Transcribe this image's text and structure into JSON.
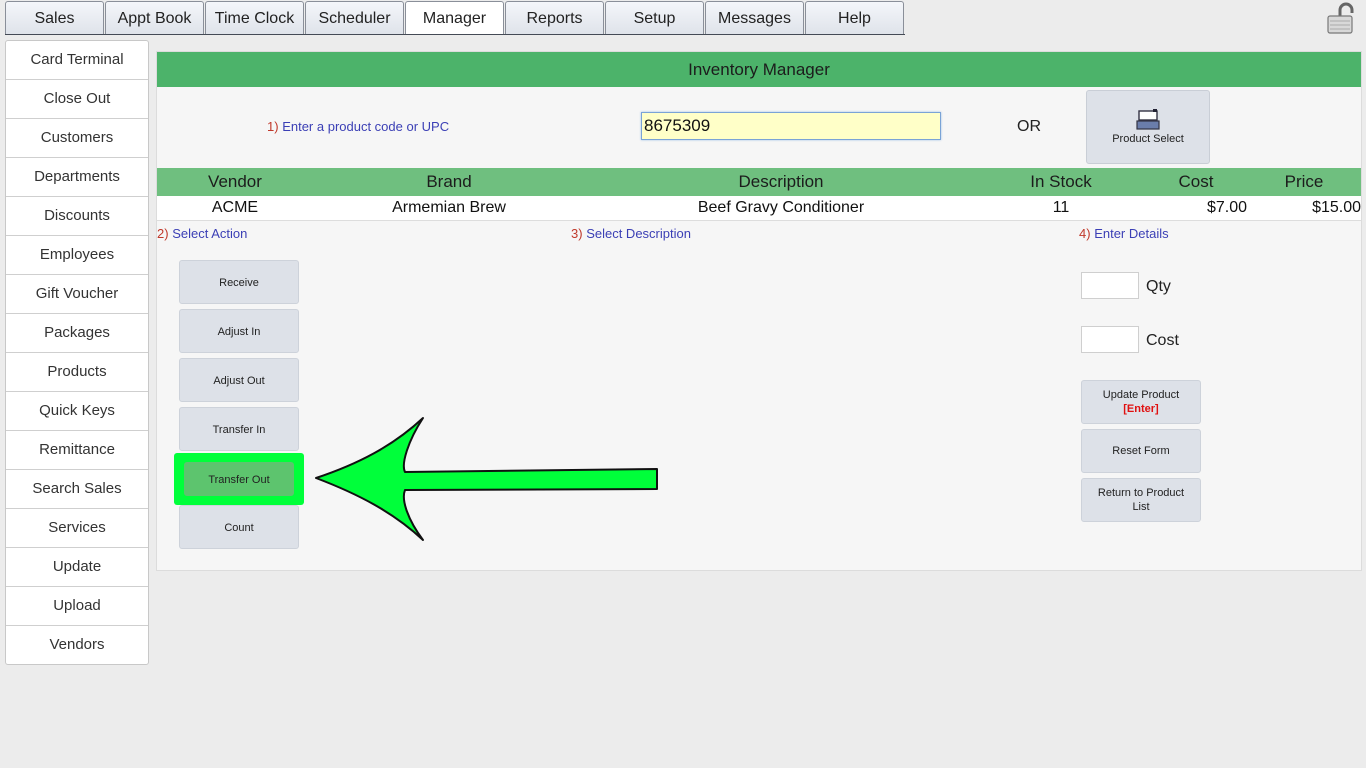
{
  "tabs": [
    "Sales",
    "Appt Book",
    "Time Clock",
    "Scheduler",
    "Manager",
    "Reports",
    "Setup",
    "Messages",
    "Help"
  ],
  "active_tab": "Manager",
  "sidebar": {
    "items": [
      "Card Terminal",
      "Close Out",
      "Customers",
      "Departments",
      "Discounts",
      "Employees",
      "Gift Voucher",
      "Packages",
      "Products",
      "Quick Keys",
      "Remittance",
      "Search Sales",
      "Services",
      "Update",
      "Upload",
      "Vendors"
    ]
  },
  "main": {
    "title": "Inventory Manager",
    "step1": {
      "num": "1)",
      "label": "Enter a product code or UPC"
    },
    "product_code_value": "8675309",
    "or_label": "OR",
    "product_select_label": "Product Select",
    "table": {
      "headers": {
        "vendor": "Vendor",
        "brand": "Brand",
        "description": "Description",
        "in_stock": "In Stock",
        "cost": "Cost",
        "price": "Price"
      },
      "row": {
        "vendor": "ACME",
        "brand": "Armemian Brew",
        "description": "Beef Gravy Conditioner",
        "in_stock": "11",
        "cost": "$7.00",
        "price": "$15.00"
      }
    },
    "step2": {
      "num": "2)",
      "label": "Select Action"
    },
    "step3": {
      "num": "3)",
      "label": "Select Description"
    },
    "step4": {
      "num": "4)",
      "label": "Enter Details"
    },
    "actions": [
      "Receive",
      "Adjust In",
      "Adjust Out",
      "Transfer In",
      "Transfer Out",
      "Count"
    ],
    "highlighted_action": "Transfer Out",
    "details": {
      "qty_label": "Qty",
      "cost_label": "Cost",
      "update_label": "Update Product",
      "update_hint": "[Enter]",
      "reset_label": "Reset Form",
      "return_label": "Return to Product List"
    }
  },
  "colors": {
    "header_green": "#4cb36a",
    "table_head_green": "#6fbf7f",
    "highlight": "#00ff3a",
    "arrow": "#00ff3a"
  },
  "icons": {
    "lock": "unlocked-padlock-icon",
    "product_select": "register-icon",
    "annotation": "left-arrow-icon"
  }
}
